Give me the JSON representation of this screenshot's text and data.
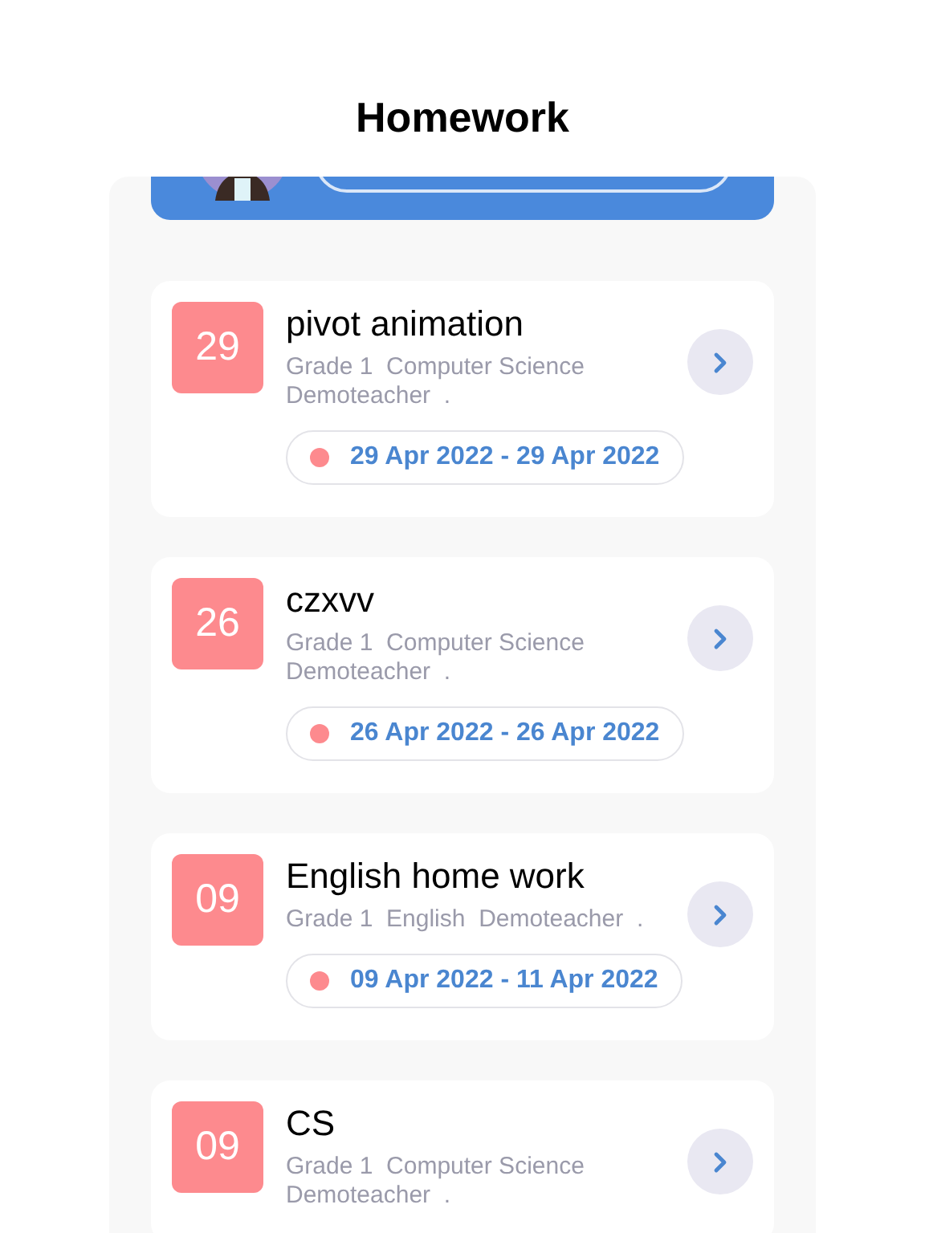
{
  "header": {
    "title": "Homework"
  },
  "homework": [
    {
      "day": "29",
      "title": "pivot animation",
      "details": "Grade 1  Computer Science  Demoteacher  .",
      "dates": "29 Apr 2022 - 29 Apr 2022"
    },
    {
      "day": "26",
      "title": "czxvv",
      "details": "Grade 1  Computer Science  Demoteacher  .",
      "dates": "26 Apr 2022 - 26 Apr 2022"
    },
    {
      "day": "09",
      "title": "English home work",
      "details": "Grade 1  English  Demoteacher  .",
      "dates": "09 Apr 2022 - 11 Apr 2022"
    },
    {
      "day": "09",
      "title": "CS",
      "details": "Grade 1  Computer Science  Demoteacher  ."
    }
  ]
}
